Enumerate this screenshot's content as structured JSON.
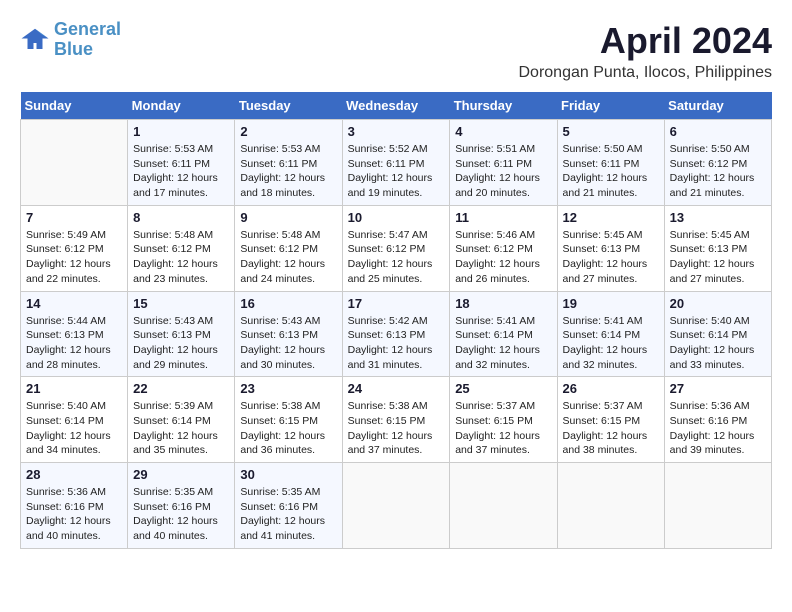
{
  "logo": {
    "line1": "General",
    "line2": "Blue"
  },
  "title": "April 2024",
  "subtitle": "Dorongan Punta, Ilocos, Philippines",
  "days_header": [
    "Sunday",
    "Monday",
    "Tuesday",
    "Wednesday",
    "Thursday",
    "Friday",
    "Saturday"
  ],
  "weeks": [
    [
      {
        "day": "",
        "sunrise": "",
        "sunset": "",
        "daylight": ""
      },
      {
        "day": "1",
        "sunrise": "Sunrise: 5:53 AM",
        "sunset": "Sunset: 6:11 PM",
        "daylight": "Daylight: 12 hours and 17 minutes."
      },
      {
        "day": "2",
        "sunrise": "Sunrise: 5:53 AM",
        "sunset": "Sunset: 6:11 PM",
        "daylight": "Daylight: 12 hours and 18 minutes."
      },
      {
        "day": "3",
        "sunrise": "Sunrise: 5:52 AM",
        "sunset": "Sunset: 6:11 PM",
        "daylight": "Daylight: 12 hours and 19 minutes."
      },
      {
        "day": "4",
        "sunrise": "Sunrise: 5:51 AM",
        "sunset": "Sunset: 6:11 PM",
        "daylight": "Daylight: 12 hours and 20 minutes."
      },
      {
        "day": "5",
        "sunrise": "Sunrise: 5:50 AM",
        "sunset": "Sunset: 6:11 PM",
        "daylight": "Daylight: 12 hours and 21 minutes."
      },
      {
        "day": "6",
        "sunrise": "Sunrise: 5:50 AM",
        "sunset": "Sunset: 6:12 PM",
        "daylight": "Daylight: 12 hours and 21 minutes."
      }
    ],
    [
      {
        "day": "7",
        "sunrise": "Sunrise: 5:49 AM",
        "sunset": "Sunset: 6:12 PM",
        "daylight": "Daylight: 12 hours and 22 minutes."
      },
      {
        "day": "8",
        "sunrise": "Sunrise: 5:48 AM",
        "sunset": "Sunset: 6:12 PM",
        "daylight": "Daylight: 12 hours and 23 minutes."
      },
      {
        "day": "9",
        "sunrise": "Sunrise: 5:48 AM",
        "sunset": "Sunset: 6:12 PM",
        "daylight": "Daylight: 12 hours and 24 minutes."
      },
      {
        "day": "10",
        "sunrise": "Sunrise: 5:47 AM",
        "sunset": "Sunset: 6:12 PM",
        "daylight": "Daylight: 12 hours and 25 minutes."
      },
      {
        "day": "11",
        "sunrise": "Sunrise: 5:46 AM",
        "sunset": "Sunset: 6:12 PM",
        "daylight": "Daylight: 12 hours and 26 minutes."
      },
      {
        "day": "12",
        "sunrise": "Sunrise: 5:45 AM",
        "sunset": "Sunset: 6:13 PM",
        "daylight": "Daylight: 12 hours and 27 minutes."
      },
      {
        "day": "13",
        "sunrise": "Sunrise: 5:45 AM",
        "sunset": "Sunset: 6:13 PM",
        "daylight": "Daylight: 12 hours and 27 minutes."
      }
    ],
    [
      {
        "day": "14",
        "sunrise": "Sunrise: 5:44 AM",
        "sunset": "Sunset: 6:13 PM",
        "daylight": "Daylight: 12 hours and 28 minutes."
      },
      {
        "day": "15",
        "sunrise": "Sunrise: 5:43 AM",
        "sunset": "Sunset: 6:13 PM",
        "daylight": "Daylight: 12 hours and 29 minutes."
      },
      {
        "day": "16",
        "sunrise": "Sunrise: 5:43 AM",
        "sunset": "Sunset: 6:13 PM",
        "daylight": "Daylight: 12 hours and 30 minutes."
      },
      {
        "day": "17",
        "sunrise": "Sunrise: 5:42 AM",
        "sunset": "Sunset: 6:13 PM",
        "daylight": "Daylight: 12 hours and 31 minutes."
      },
      {
        "day": "18",
        "sunrise": "Sunrise: 5:41 AM",
        "sunset": "Sunset: 6:14 PM",
        "daylight": "Daylight: 12 hours and 32 minutes."
      },
      {
        "day": "19",
        "sunrise": "Sunrise: 5:41 AM",
        "sunset": "Sunset: 6:14 PM",
        "daylight": "Daylight: 12 hours and 32 minutes."
      },
      {
        "day": "20",
        "sunrise": "Sunrise: 5:40 AM",
        "sunset": "Sunset: 6:14 PM",
        "daylight": "Daylight: 12 hours and 33 minutes."
      }
    ],
    [
      {
        "day": "21",
        "sunrise": "Sunrise: 5:40 AM",
        "sunset": "Sunset: 6:14 PM",
        "daylight": "Daylight: 12 hours and 34 minutes."
      },
      {
        "day": "22",
        "sunrise": "Sunrise: 5:39 AM",
        "sunset": "Sunset: 6:14 PM",
        "daylight": "Daylight: 12 hours and 35 minutes."
      },
      {
        "day": "23",
        "sunrise": "Sunrise: 5:38 AM",
        "sunset": "Sunset: 6:15 PM",
        "daylight": "Daylight: 12 hours and 36 minutes."
      },
      {
        "day": "24",
        "sunrise": "Sunrise: 5:38 AM",
        "sunset": "Sunset: 6:15 PM",
        "daylight": "Daylight: 12 hours and 37 minutes."
      },
      {
        "day": "25",
        "sunrise": "Sunrise: 5:37 AM",
        "sunset": "Sunset: 6:15 PM",
        "daylight": "Daylight: 12 hours and 37 minutes."
      },
      {
        "day": "26",
        "sunrise": "Sunrise: 5:37 AM",
        "sunset": "Sunset: 6:15 PM",
        "daylight": "Daylight: 12 hours and 38 minutes."
      },
      {
        "day": "27",
        "sunrise": "Sunrise: 5:36 AM",
        "sunset": "Sunset: 6:16 PM",
        "daylight": "Daylight: 12 hours and 39 minutes."
      }
    ],
    [
      {
        "day": "28",
        "sunrise": "Sunrise: 5:36 AM",
        "sunset": "Sunset: 6:16 PM",
        "daylight": "Daylight: 12 hours and 40 minutes."
      },
      {
        "day": "29",
        "sunrise": "Sunrise: 5:35 AM",
        "sunset": "Sunset: 6:16 PM",
        "daylight": "Daylight: 12 hours and 40 minutes."
      },
      {
        "day": "30",
        "sunrise": "Sunrise: 5:35 AM",
        "sunset": "Sunset: 6:16 PM",
        "daylight": "Daylight: 12 hours and 41 minutes."
      },
      {
        "day": "",
        "sunrise": "",
        "sunset": "",
        "daylight": ""
      },
      {
        "day": "",
        "sunrise": "",
        "sunset": "",
        "daylight": ""
      },
      {
        "day": "",
        "sunrise": "",
        "sunset": "",
        "daylight": ""
      },
      {
        "day": "",
        "sunrise": "",
        "sunset": "",
        "daylight": ""
      }
    ]
  ]
}
